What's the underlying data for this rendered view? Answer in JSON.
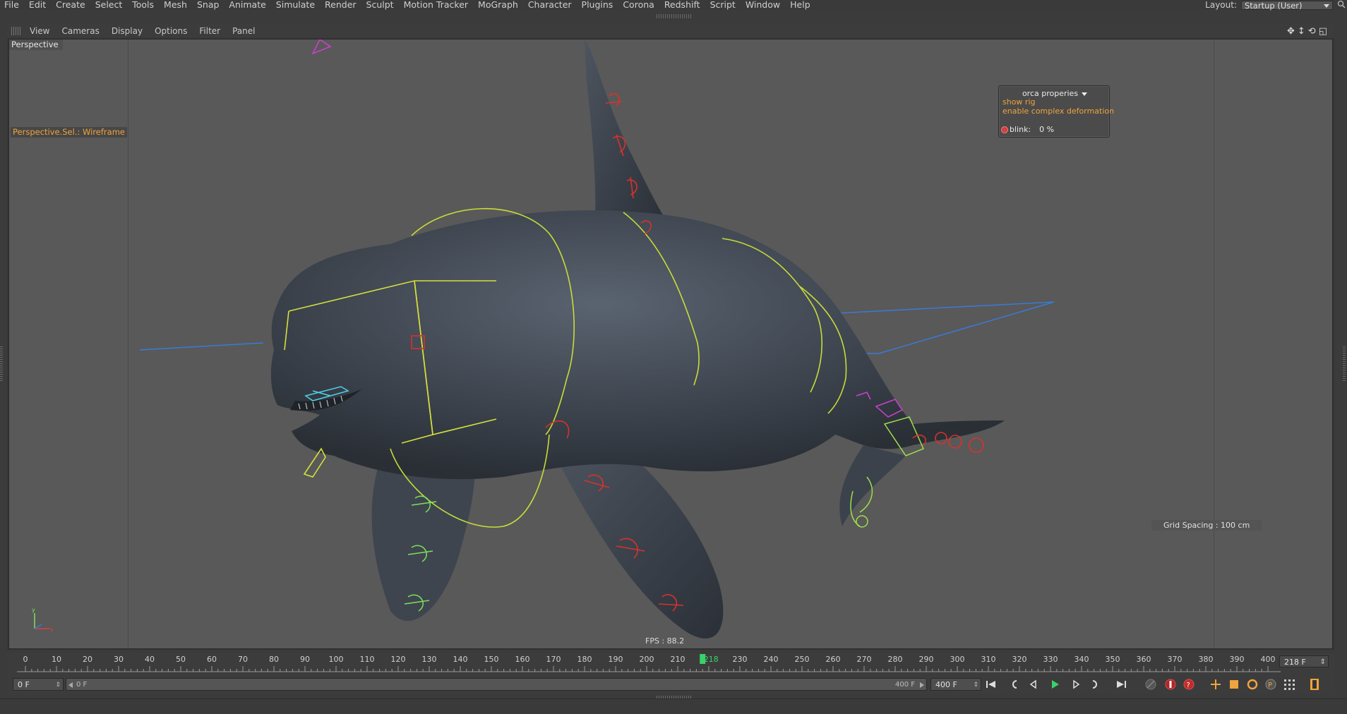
{
  "menu": [
    "File",
    "Edit",
    "Create",
    "Select",
    "Tools",
    "Mesh",
    "Snap",
    "Animate",
    "Simulate",
    "Render",
    "Sculpt",
    "Motion Tracker",
    "MoGraph",
    "Character",
    "Plugins",
    "Corona",
    "Redshift",
    "Script",
    "Window",
    "Help"
  ],
  "layout": {
    "label": "Layout:",
    "value": "Startup (User)"
  },
  "viewport_menu": [
    "View",
    "Cameras",
    "Display",
    "Options",
    "Filter",
    "Panel"
  ],
  "viewport": {
    "camera_label": "Perspective",
    "selection_label": "Perspective.Sel.: Wireframe",
    "fps": "FPS : 88.2",
    "grid_spacing": "Grid Spacing : 100 cm",
    "background": "#595959"
  },
  "orca_panel": {
    "title": "orca properies",
    "items": [
      "show rig",
      "enable complex deformation"
    ],
    "blink_label": "blink:",
    "blink_value": "0 %"
  },
  "timeline": {
    "ticks": [
      "0",
      "10",
      "20",
      "30",
      "40",
      "50",
      "60",
      "70",
      "80",
      "90",
      "100",
      "110",
      "120",
      "130",
      "140",
      "150",
      "160",
      "170",
      "180",
      "190",
      "200",
      "210",
      "218",
      "230",
      "240",
      "250",
      "260",
      "270",
      "280",
      "290",
      "300",
      "310",
      "320",
      "330",
      "340",
      "350",
      "360",
      "370",
      "380",
      "390",
      "400"
    ],
    "current_frame": 218,
    "current_frame_label": "218",
    "frame_field": "218 F",
    "min": 0,
    "max": 400
  },
  "transport": {
    "start_field": "0 F",
    "range_start": "0 F",
    "range_end": "400 F",
    "end_field": "400 F"
  },
  "colors": {
    "accent_orange": "#f0a43c",
    "rig_yellow": "#d6e03a",
    "rig_green": "#9be04a",
    "rig_red": "#d8322c",
    "rig_blue": "#3a7ad8",
    "rig_magenta": "#d040d0",
    "playhead": "#39d26a"
  }
}
